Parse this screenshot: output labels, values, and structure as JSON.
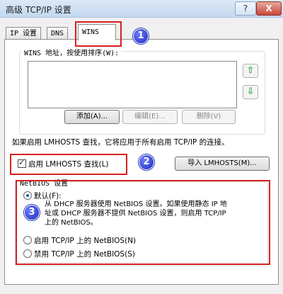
{
  "window": {
    "title": "高级 TCP/IP 设置",
    "help_label": "?",
    "close_label": "X"
  },
  "tabs": [
    {
      "label": "IP 设置"
    },
    {
      "label": "DNS"
    },
    {
      "label": "WINS"
    }
  ],
  "wins": {
    "group_label": "WINS 地址，按使用排序(W):",
    "add_label": "添加(A)...",
    "edit_label": "编辑(E)...",
    "delete_label": "删除(V)",
    "up_label": "⇧",
    "down_label": "⇩"
  },
  "lmhosts": {
    "info_text": "如果启用 LMHOSTS 查找，它将应用于所有启用 TCP/IP 的连接。",
    "enable_label": "启用 LMHOSTS 查找(L)",
    "enable_checked": true,
    "import_label": "导入 LMHOSTS(M)..."
  },
  "netbios": {
    "group_label": "NetBIOS 设置",
    "default_label": "默认(F):",
    "default_desc_1": "从 DHCP 服务器使用 NetBIOS 设置。如果使用静态 IP 地",
    "default_desc_2": "址或 DHCP 服务器不提供 NetBIOS 设置，则启用 TCP/IP",
    "default_desc_3": "上的 NetBIOS。",
    "enable_label": "启用 TCP/IP 上的 NetBIOS(N)",
    "disable_label": "禁用 TCP/IP 上的 NetBIOS(S)",
    "selected": "default"
  },
  "annotations": [
    "1",
    "2",
    "3"
  ]
}
